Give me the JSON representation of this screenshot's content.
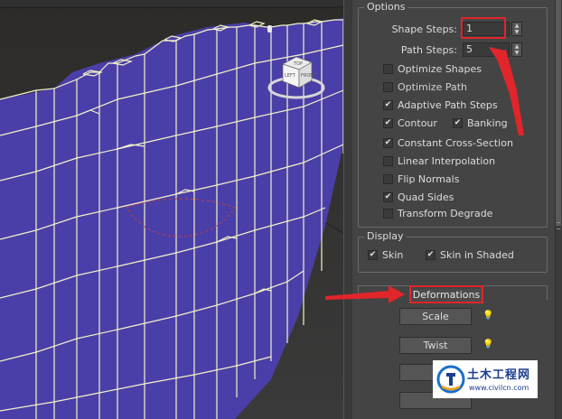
{
  "options_group": {
    "title": "Options",
    "shape_steps": {
      "label": "Shape Steps:",
      "value": "1"
    },
    "path_steps": {
      "label": "Path Steps:",
      "value": "5"
    },
    "checkboxes": [
      {
        "label": "Optimize Shapes",
        "checked": false
      },
      {
        "label": "Optimize Path",
        "checked": false
      },
      {
        "label": "Adaptive Path Steps",
        "checked": true
      },
      {
        "label": "Contour",
        "checked": true
      },
      {
        "label": "Banking",
        "checked": true
      },
      {
        "label": "Constant Cross-Section",
        "checked": true
      },
      {
        "label": "Linear Interpolation",
        "checked": false
      },
      {
        "label": "Flip Normals",
        "checked": false
      },
      {
        "label": "Quad Sides",
        "checked": true
      },
      {
        "label": "Transform Degrade",
        "checked": false
      }
    ]
  },
  "display_group": {
    "title": "Display",
    "skin": {
      "label": "Skin",
      "checked": true
    },
    "skin_in_shaded": {
      "label": "Skin in Shaded",
      "checked": true
    }
  },
  "deformations": {
    "title": "Deformations",
    "scale_label": "Scale",
    "twist_label": "Twist"
  },
  "viewcube": {
    "face_top": "TOP",
    "face_left": "LEFT",
    "face_front": "FRONT"
  },
  "watermark": {
    "title": "土木工程网",
    "url": "www.civilcn.com"
  },
  "colors": {
    "panel_bg": "#444444",
    "viewport_bg": "#2b2a27",
    "mesh_fill": "#4a3fa8",
    "mesh_edge": "#f4f2c8",
    "highlight_red": "#e0252b"
  }
}
